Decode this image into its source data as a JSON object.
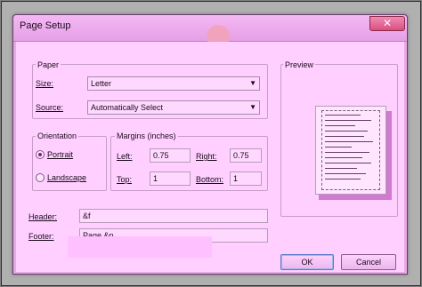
{
  "window": {
    "title": "Page Setup",
    "close_glyph": "✕"
  },
  "paper": {
    "group_label": "Paper",
    "size_label": "Size:",
    "size_value": "Letter",
    "source_label": "Source:",
    "source_value": "Automatically Select"
  },
  "preview": {
    "group_label": "Preview"
  },
  "orientation": {
    "group_label": "Orientation",
    "portrait_label": "Portrait",
    "landscape_label": "Landscape",
    "selected": "Portrait"
  },
  "margins": {
    "group_label": "Margins (inches)",
    "left_label": "Left:",
    "left_value": "0.75",
    "right_label": "Right:",
    "right_value": "0.75",
    "top_label": "Top:",
    "top_value": "1",
    "bottom_label": "Bottom:",
    "bottom_value": "1"
  },
  "header": {
    "label": "Header:",
    "value": "&f"
  },
  "footer": {
    "label": "Footer:",
    "value": "Page &p"
  },
  "buttons": {
    "ok": "OK",
    "cancel": "Cancel"
  },
  "icons": {
    "dropdown": "▼"
  },
  "colors": {
    "client_bg": "#ffd0ff",
    "title_bg": "#f4b8f4",
    "close_bg": "#d8507e",
    "preview_shadow": "#d07ad0"
  }
}
